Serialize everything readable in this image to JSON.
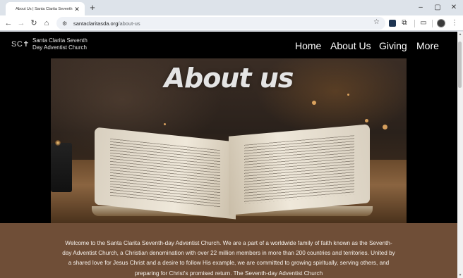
{
  "browser": {
    "tab_title": "About Us | Santa Clarita Seventh",
    "url_host": "santaclaritasda.org",
    "url_path": "/about-us",
    "icons": [
      "back-icon",
      "forward-icon",
      "reload-icon",
      "home-icon",
      "tune-icon",
      "star-icon",
      "extensions-icon",
      "side-panel-icon",
      "profile-avatar",
      "menu-icon"
    ]
  },
  "site": {
    "logo": "SC✝",
    "name_line1": "Santa Clarita Seventh",
    "name_line2": "Day Adventist Church",
    "nav": [
      "Home",
      "About Us",
      "Giving",
      "More"
    ]
  },
  "hero": {
    "title": "About us"
  },
  "content": {
    "intro": "Welcome to the Santa Clarita Seventh-day Adventist Church. We are a part of a worldwide family of faith known as the Seventh-day Adventist Church, a Christian denomination with over 22 million members in more than 200 countries and territories. United by a shared love for Jesus Christ and a desire to follow His example, we are committed to growing spiritually, serving others, and preparing for Christ's promised return. The Seventh-day Adventist Church"
  },
  "colors": {
    "content_bg": "#6f4e37",
    "page_bg": "#000000",
    "tabstrip_bg": "#dde3ea"
  }
}
